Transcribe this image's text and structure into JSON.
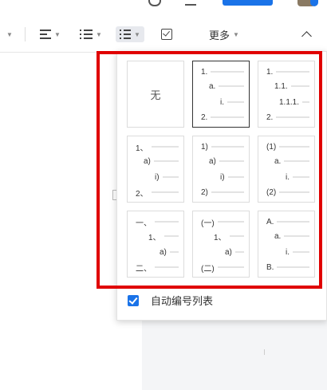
{
  "toolbar": {
    "more_label": "更多"
  },
  "list_menu": {
    "none_label": "无",
    "styles": [
      {
        "rows": [
          [
            "1.",
            10
          ],
          [
            "a.",
            20
          ],
          [
            "i.",
            34
          ],
          [
            "2.",
            10
          ]
        ]
      },
      {
        "rows": [
          [
            "1.",
            10
          ],
          [
            "1.1.",
            20
          ],
          [
            "1.1.1.",
            26
          ],
          [
            "2.",
            10
          ]
        ]
      },
      {
        "rows": [
          [
            "1、",
            10
          ],
          [
            "a)",
            20
          ],
          [
            "i)",
            34
          ],
          [
            "2、",
            10
          ]
        ]
      },
      {
        "rows": [
          [
            "1)",
            10
          ],
          [
            "a)",
            20
          ],
          [
            "i)",
            34
          ],
          [
            "2)",
            10
          ]
        ]
      },
      {
        "rows": [
          [
            "(1)",
            10
          ],
          [
            "a.",
            20
          ],
          [
            "i.",
            34
          ],
          [
            "(2)",
            10
          ]
        ]
      },
      {
        "rows": [
          [
            "一、",
            10
          ],
          [
            "1、",
            26
          ],
          [
            "a)",
            40
          ],
          [
            "二、",
            10
          ]
        ]
      },
      {
        "rows": [
          [
            "(一)",
            10
          ],
          [
            "1、",
            26
          ],
          [
            "a)",
            40
          ],
          [
            "(二)",
            10
          ]
        ]
      },
      {
        "rows": [
          [
            "A.",
            10
          ],
          [
            "a.",
            20
          ],
          [
            "i.",
            34
          ],
          [
            "B.",
            10
          ]
        ]
      }
    ],
    "auto_number": {
      "label": "自动编号列表",
      "checked": true
    }
  },
  "colors": {
    "accent": "#1a73e8",
    "highlight": "#e00000"
  }
}
